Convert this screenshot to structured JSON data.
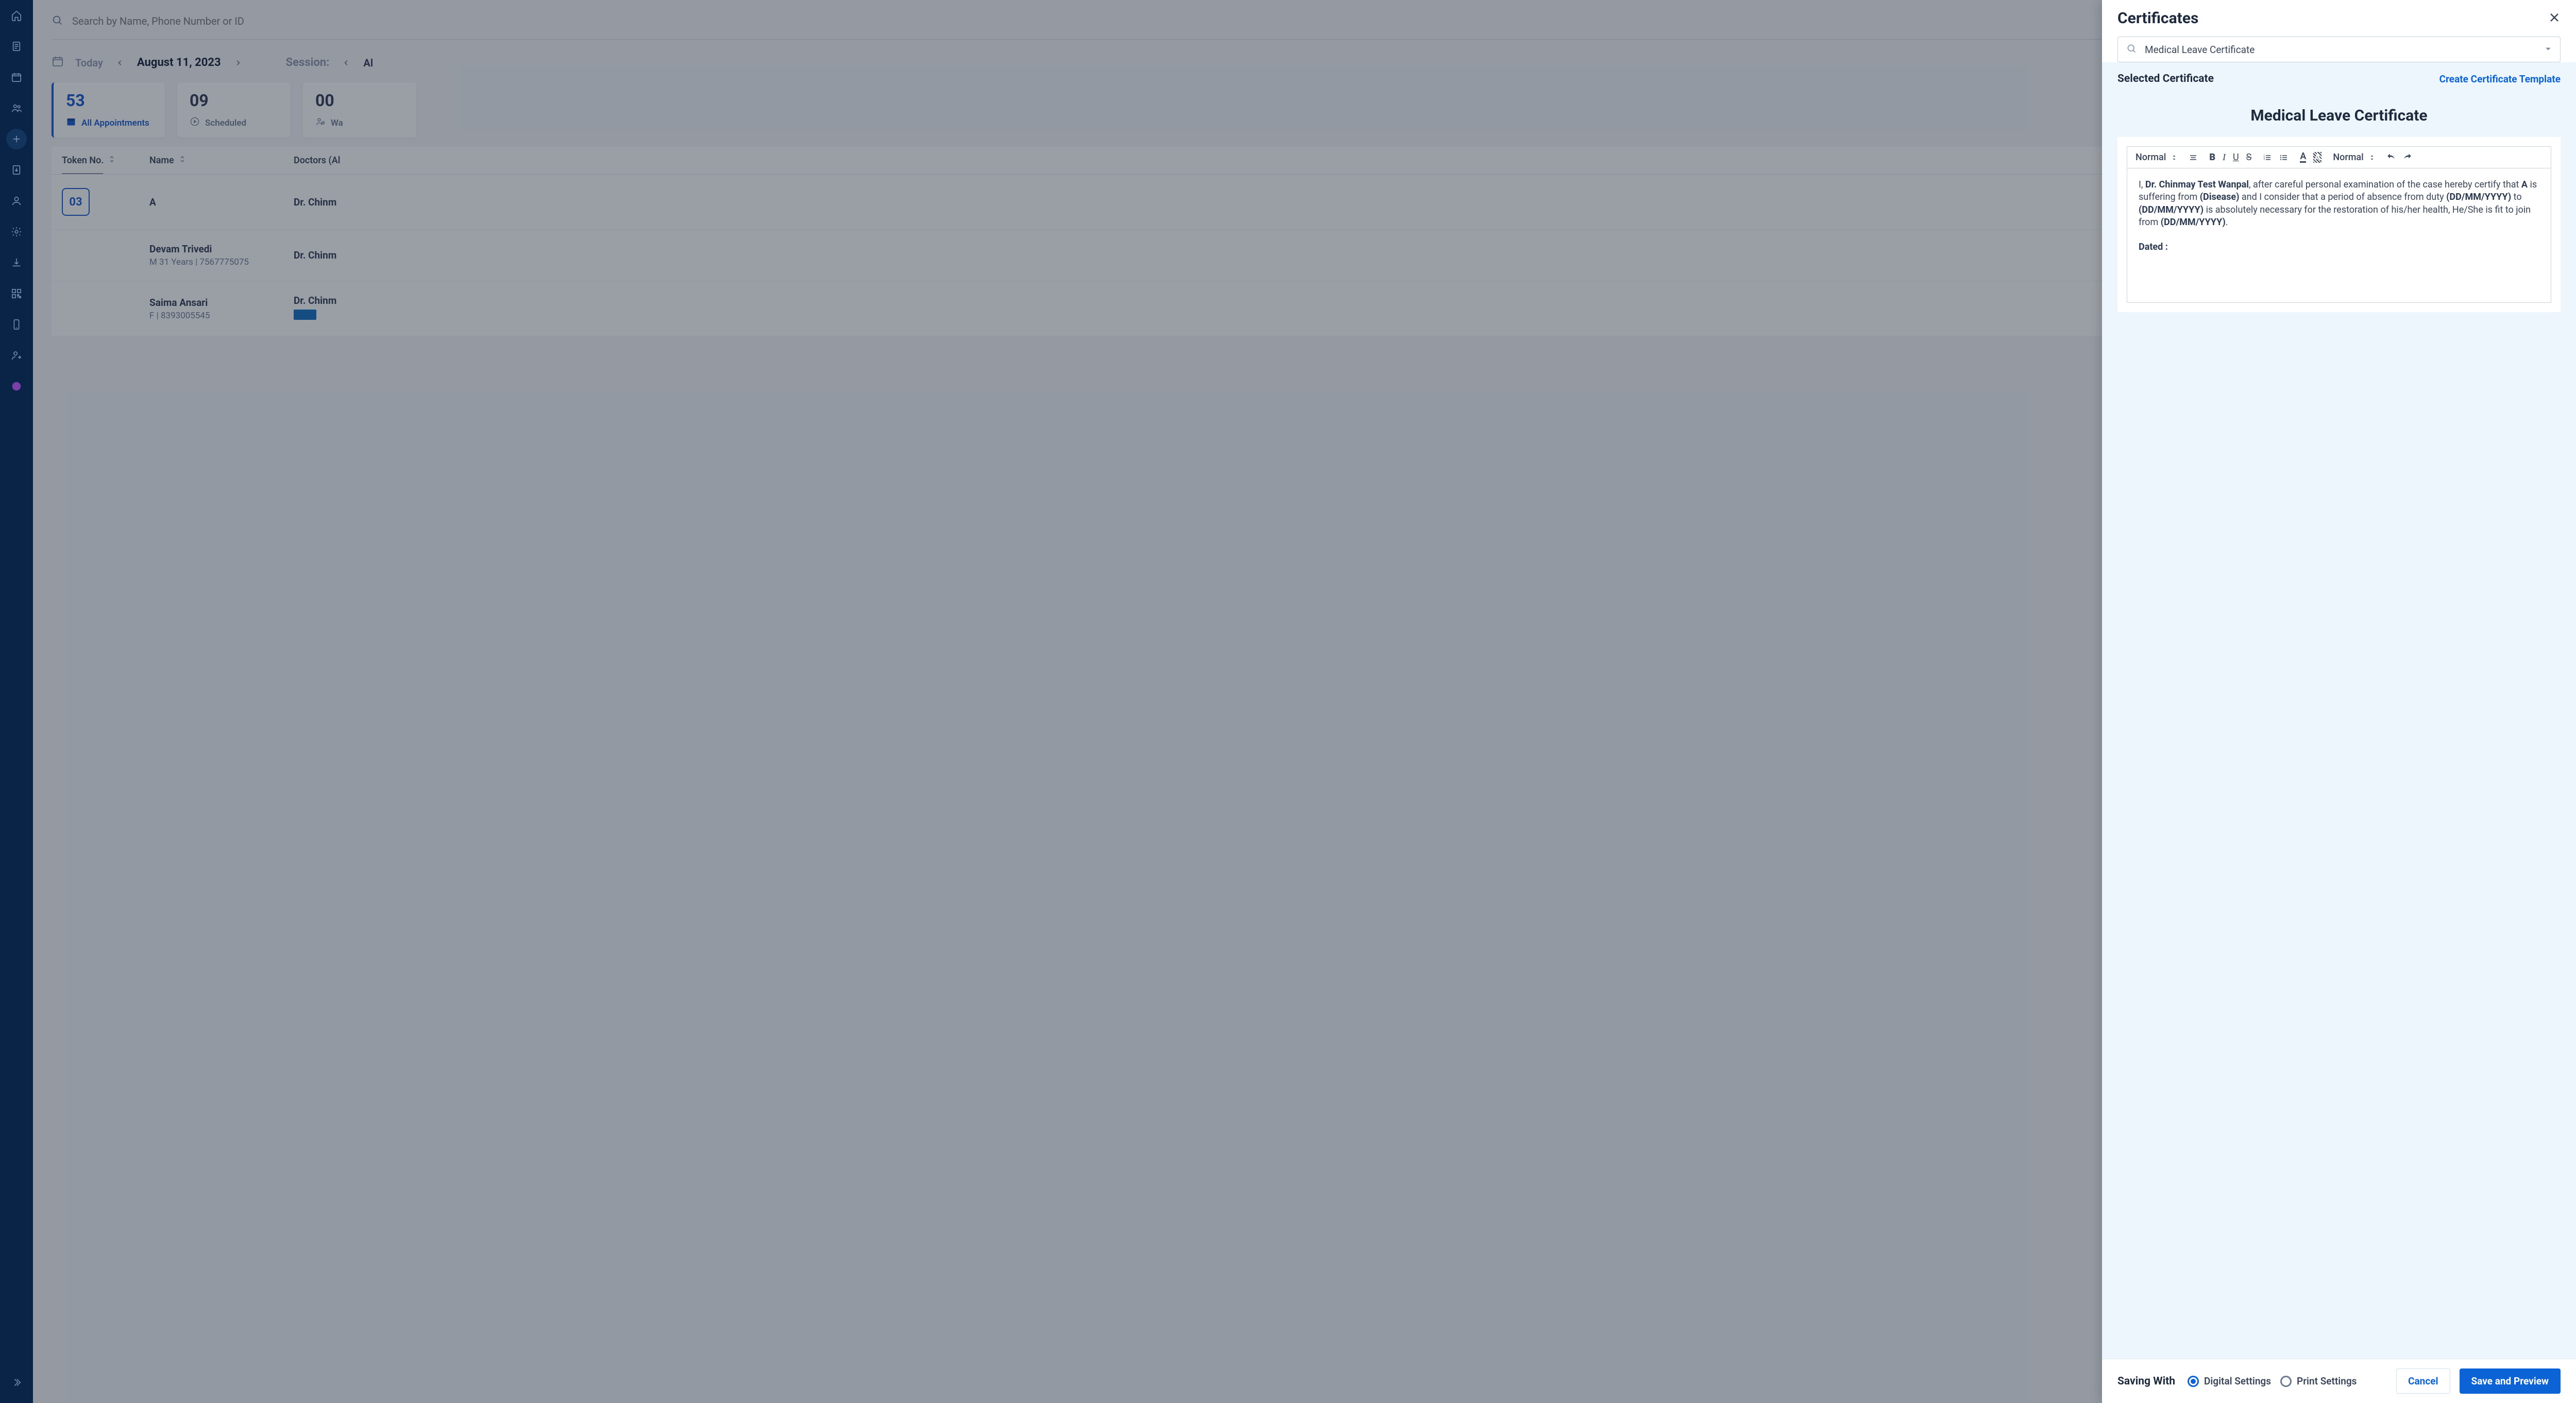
{
  "search": {
    "placeholder": "Search by Name, Phone Number or ID"
  },
  "datebar": {
    "today": "Today",
    "date": "August 11, 2023",
    "session_label": "Session:",
    "session_all_prefix": "Al"
  },
  "stats": {
    "all": {
      "count": "53",
      "label": "All Appointments"
    },
    "scheduled": {
      "count": "09",
      "label": "Scheduled"
    },
    "waiting": {
      "count": "00",
      "label_prefix": "Wa"
    }
  },
  "table": {
    "headers": {
      "token": "Token No.",
      "name": "Name",
      "doctors": "Doctors (Al"
    },
    "rows": [
      {
        "token": "03",
        "name": "A",
        "sub": "",
        "doctor": "Dr. Chinm",
        "badge": false
      },
      {
        "token": "",
        "name": "Devam Trivedi",
        "sub": "M   31 Years  |  7567775075",
        "doctor": "Dr. Chinm",
        "badge": false
      },
      {
        "token": "",
        "name": "Saima Ansari",
        "sub": "F  |  8393005545",
        "doctor": "Dr. Chinm",
        "badge": true
      }
    ]
  },
  "drawer": {
    "title": "Certificates",
    "search_value": "Medical Leave Certificate",
    "selected_label": "Selected Certificate",
    "create_link": "Create Certificate Template",
    "doc_title": "Medical Leave Certificate",
    "toolbar": {
      "heading": "Normal",
      "size": "Normal"
    },
    "body": {
      "t1": "I, ",
      "b1": "Dr. Chinmay Test Wanpal",
      "t2": ", after careful personal examination of the case hereby certify that ",
      "b2": "A",
      "t3": " is suffering from ",
      "b3": "(Disease)",
      "t4": " and I consider that a period of absence from duty ",
      "b4": "(DD/MM/YYYY)",
      "t5": " to ",
      "b5": "(DD/MM/YYYY)",
      "t6": " is absolutely necessary for the restoration of his/her health, He/She is fit to join from ",
      "b6": "(DD/MM/YYYY)",
      "t7": ".",
      "dated": "Dated :"
    },
    "footer": {
      "saving_with": "Saving With",
      "opt1": "Digital Settings",
      "opt2": "Print Settings",
      "cancel": "Cancel",
      "save": "Save and Preview"
    }
  }
}
